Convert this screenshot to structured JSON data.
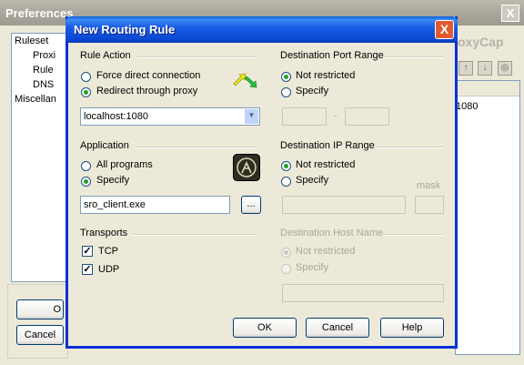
{
  "background_window": {
    "title": "Preferences",
    "close_glyph": "X",
    "tree": [
      "Ruleset",
      "Proxi",
      "Rule",
      "DNS",
      "Miscellan"
    ],
    "branding_fragment": "oxyCap",
    "list_value": "1080",
    "button_fragment": "O",
    "cancel_label": "Cancel"
  },
  "dialog": {
    "title": "New Routing Rule",
    "close_glyph": "X",
    "rule_action": {
      "heading": "Rule Action",
      "options": [
        "Force direct connection",
        "Redirect through proxy"
      ],
      "selected": "Redirect through proxy",
      "proxy_value": "localhost:1080"
    },
    "application": {
      "heading": "Application",
      "options": [
        "All programs",
        "Specify"
      ],
      "selected": "Specify",
      "program_value": "sro_client.exe",
      "browse_label": "..."
    },
    "transports": {
      "heading": "Transports",
      "tcp_label": "TCP",
      "udp_label": "UDP",
      "tcp_checked": true,
      "udp_checked": true,
      "check_glyph": "✓"
    },
    "dest_port": {
      "heading": "Destination Port Range",
      "options": [
        "Not restricted",
        "Specify"
      ],
      "selected": "Not restricted",
      "separator": "-"
    },
    "dest_ip": {
      "heading": "Destination IP Range",
      "options": [
        "Not restricted",
        "Specify"
      ],
      "selected": "Not restricted",
      "mask_label": "mask"
    },
    "dest_host": {
      "heading": "Destination Host Name",
      "options": [
        "Not restricted",
        "Specify"
      ],
      "selected": "Not restricted"
    },
    "buttons": {
      "ok": "OK",
      "cancel": "Cancel",
      "help": "Help"
    }
  },
  "icons": {
    "swap_arrows": "swap-arrows-icon",
    "app_badge": "application-badge-icon",
    "toolbar": [
      "up-arrow-icon",
      "down-arrow-icon",
      "settings-icon"
    ]
  }
}
